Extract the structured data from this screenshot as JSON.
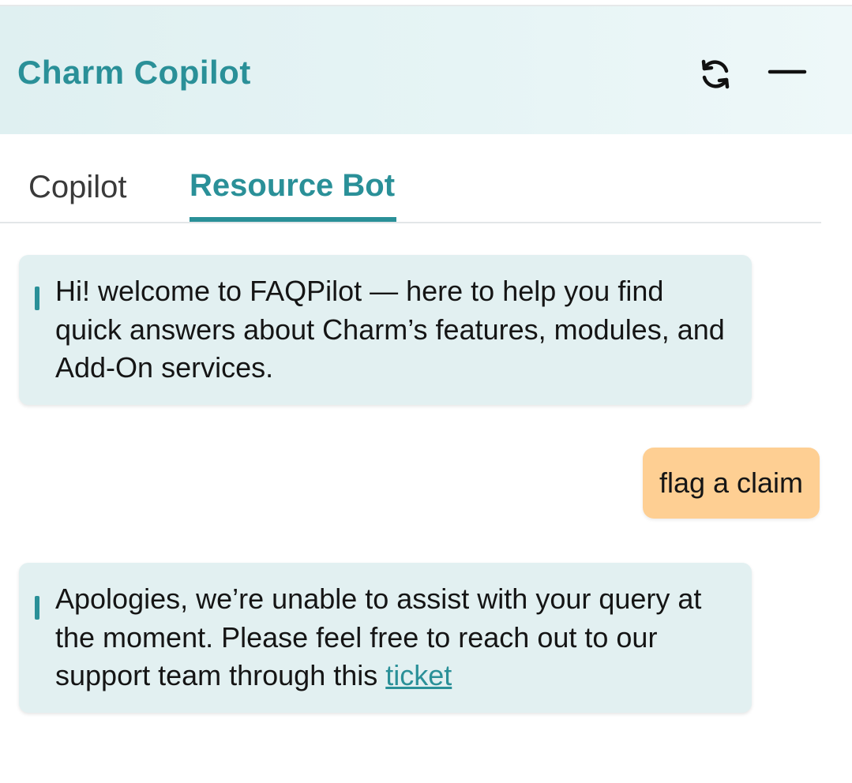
{
  "header": {
    "title": "Charm Copilot",
    "refresh_icon": "refresh-icon",
    "minimize_icon": "minimize-icon"
  },
  "tabs": [
    {
      "label": "Copilot",
      "active": false
    },
    {
      "label": "Resource Bot",
      "active": true
    }
  ],
  "messages": {
    "welcome": {
      "sender": "bot",
      "text": "Hi! welcome to FAQPilot — here to help you find quick answers about Charm’s features, modules, and Add-On services."
    },
    "user": {
      "sender": "user",
      "text": "flag a claim"
    },
    "reply": {
      "sender": "bot",
      "text": "Apologies, we’re unable to assist with your query at the moment. Please feel free to reach out to our support team through this ",
      "link_text": "ticket"
    }
  },
  "colors": {
    "accent": "#2a9098",
    "header_bg": "#e2f2f3",
    "bot_bubble": "#e2f0f1",
    "user_bubble": "#fecf93"
  }
}
